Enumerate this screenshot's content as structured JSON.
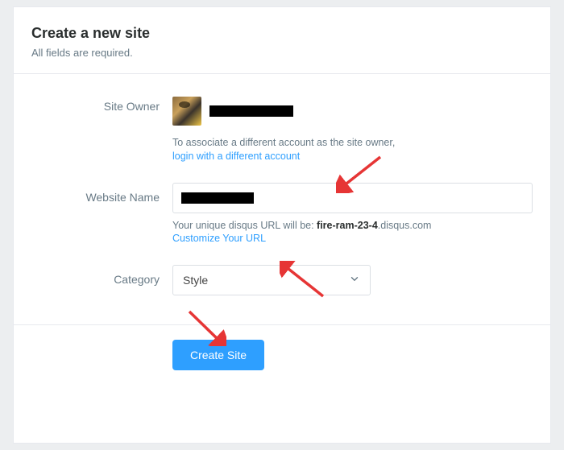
{
  "header": {
    "title": "Create a new site",
    "subtitle": "All fields are required."
  },
  "form": {
    "site_owner": {
      "label": "Site Owner",
      "associate_text": "To associate a different account as the site owner,",
      "login_link": "login with a different account"
    },
    "website_name": {
      "label": "Website Name",
      "url_prefix_text": "Your unique disqus URL will be: ",
      "url_slug": "fire-ram-23-4",
      "url_suffix": ".disqus.com",
      "customize_link": "Customize Your URL"
    },
    "category": {
      "label": "Category",
      "selected": "Style"
    }
  },
  "footer": {
    "create_button": "Create Site"
  }
}
